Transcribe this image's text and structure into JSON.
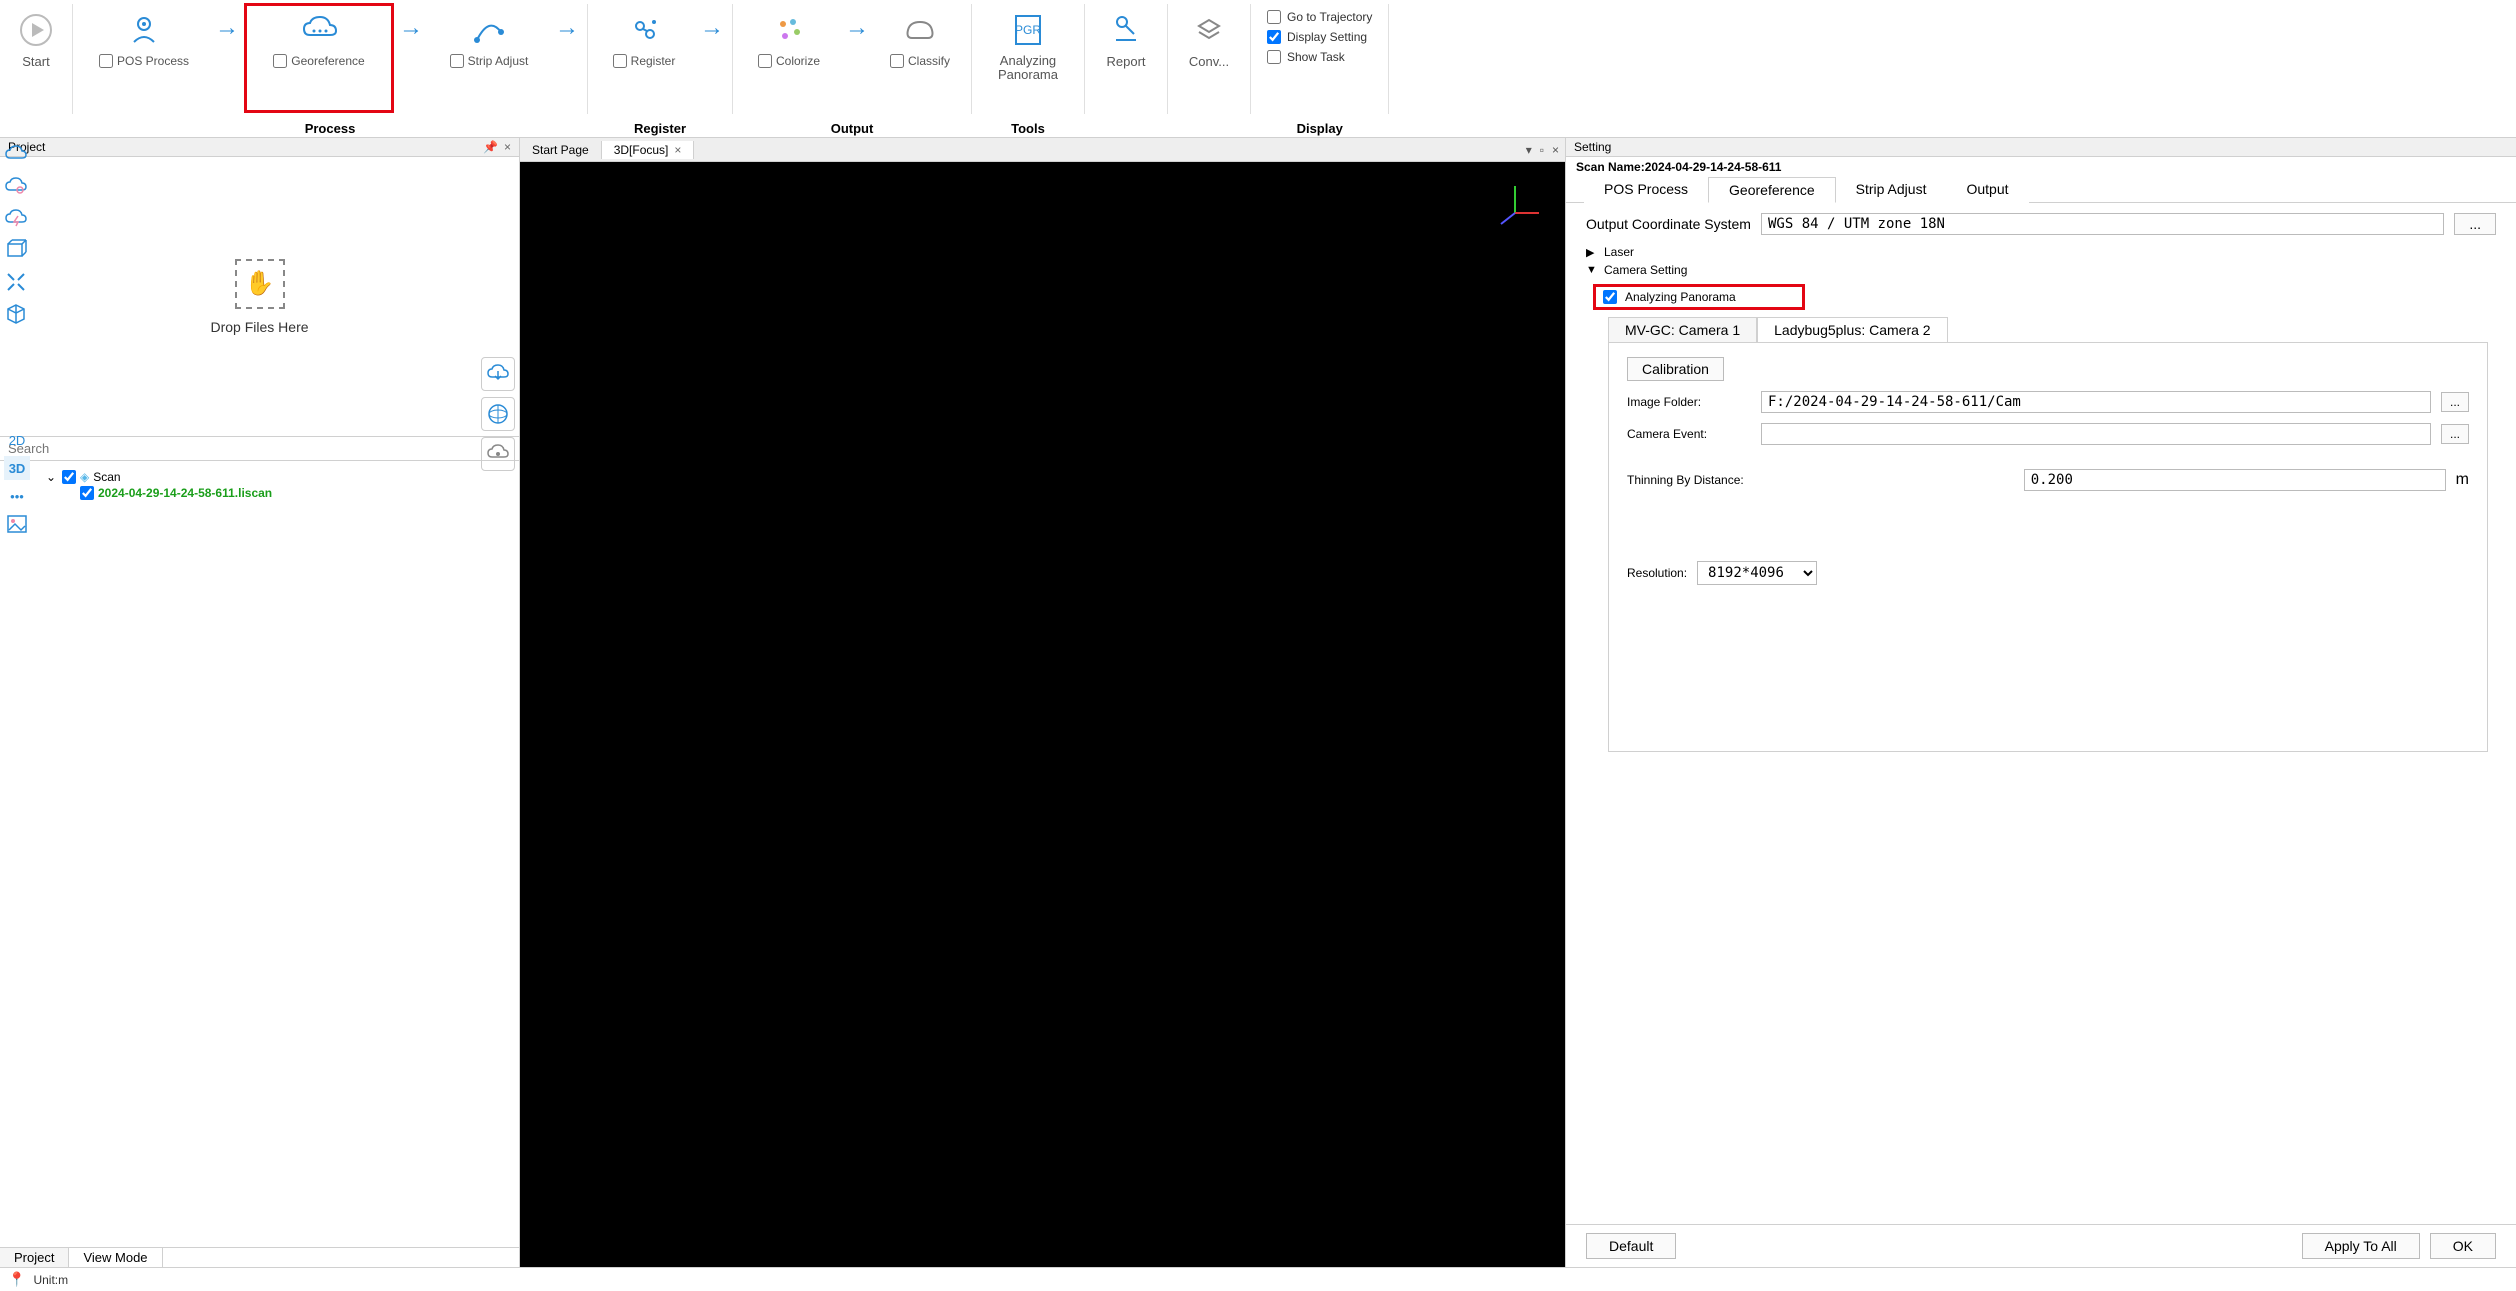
{
  "ribbon": {
    "start": "Start",
    "pos_process": "POS Process",
    "georeference": "Georeference",
    "strip_adjust": "Strip Adjust",
    "register": "Register",
    "colorize": "Colorize",
    "classify": "Classify",
    "analyzing_panorama": "Analyzing\nPanorama",
    "report": "Report",
    "conv": "Conv...",
    "group_process": "Process",
    "group_register": "Register",
    "group_output": "Output",
    "group_tools": "Tools",
    "group_display": "Display",
    "go_to_trajectory": "Go to Trajectory",
    "display_setting": "Display Setting",
    "show_task": "Show Task"
  },
  "project": {
    "title": "Project",
    "drop": "Drop Files Here",
    "search_placeholder": "Search",
    "scan_root": "Scan",
    "scan_file": "2024-04-29-14-24-58-611.liscan",
    "tab_project": "Project",
    "tab_viewmode": "View Mode",
    "nav_2d": "2D",
    "nav_3d": "3D"
  },
  "viewport": {
    "tab_start": "Start Page",
    "tab_3d": "3D[Focus]"
  },
  "settings": {
    "title": "Setting",
    "scan_name_label": "Scan Name:",
    "scan_name_value": "2024-04-29-14-24-58-611",
    "tabs": {
      "pos": "POS Process",
      "geo": "Georeference",
      "strip": "Strip Adjust",
      "output": "Output"
    },
    "ocs_label": "Output Coordinate System",
    "ocs_value": "WGS 84 / UTM zone 18N",
    "laser": "Laser",
    "camera_setting": "Camera Setting",
    "analyzing_panorama": "Analyzing Panorama",
    "cam_tab1": "MV-GC: Camera 1",
    "cam_tab2": "Ladybug5plus: Camera 2",
    "calibration": "Calibration",
    "image_folder_label": "Image Folder:",
    "image_folder_value": "F:/2024-04-29-14-24-58-611/Cam",
    "camera_event_label": "Camera Event:",
    "camera_event_value": "",
    "thinning_label": "Thinning By Distance:",
    "thinning_value": "0.200",
    "thinning_unit": "m",
    "resolution_label": "Resolution:",
    "resolution_value": "8192*4096",
    "default": "Default",
    "apply_all": "Apply To All",
    "ok": "OK"
  },
  "status": {
    "unit": "Unit:m"
  },
  "glyph": {
    "dots": "..."
  }
}
